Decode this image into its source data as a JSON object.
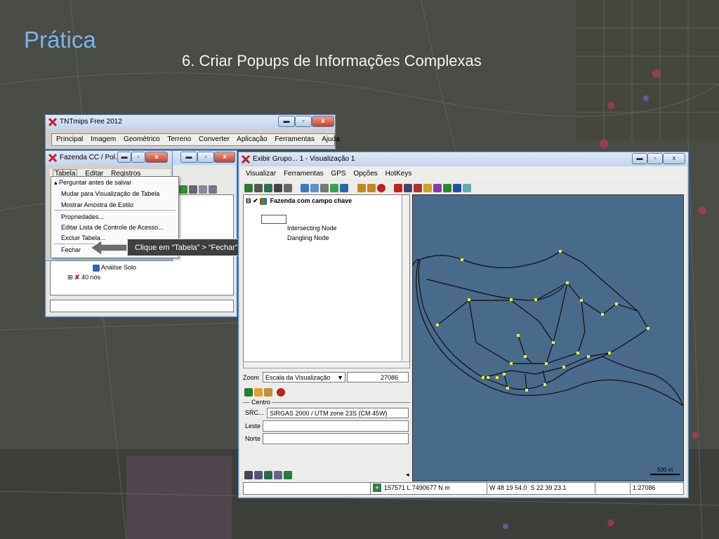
{
  "slide": {
    "title": "Prática",
    "subtitle": "6. Criar Popups de Informações Complexas"
  },
  "main_window": {
    "title": "TNTmips Free 2012",
    "menus": [
      "Principal",
      "Imagem",
      "Geométrico",
      "Terreno",
      "Converter",
      "Aplicação",
      "Ferramentas",
      "Ajuda"
    ]
  },
  "layer_window": {
    "title": "Fazenda CC / Pol...",
    "menus": [
      "Tabela",
      "Editar",
      "Registros"
    ],
    "tree_items": [
      "Análise Solo",
      "40 nós"
    ]
  },
  "context_menu": {
    "items": [
      "Perguntar antes de salvar",
      "Mudar para Visualização de Tabela",
      "Mostrar Amostra de Estilo",
      "Propriedades...",
      "Editar Lista de Controle de Acesso...",
      "Excluir Tabela...",
      "Fechar"
    ]
  },
  "callout": {
    "text": "Clique em “Tabela” > “Fechar” ."
  },
  "view_window": {
    "title": "Exibir Grupo... 1 - Visualização 1",
    "menus": [
      "Visualizar",
      "Ferramentas",
      "GPS",
      "Opções",
      "HotKeys"
    ],
    "legend": {
      "layer_name": "Fazenda com campo chave",
      "items": [
        "Intersecting Node",
        "Dangling Node"
      ]
    },
    "zoom": {
      "label": "Zoom",
      "mode": "Escala da Visualização",
      "value": "27086"
    },
    "centro": {
      "group_label": "Centro",
      "src_label": "SRC...",
      "src_value": "SIRGAS 2000 / UTM zone 23S (CM 45W)",
      "leste_label": "Leste",
      "norte_label": "Norte"
    },
    "status": {
      "coords": "157571 L 7490677 N m",
      "latlon": "W 48 19 54.0  S 22 39 23.1",
      "scale": "1:27086"
    },
    "scalebar_label": "500 m",
    "map_bg": "#4a6a8a"
  }
}
